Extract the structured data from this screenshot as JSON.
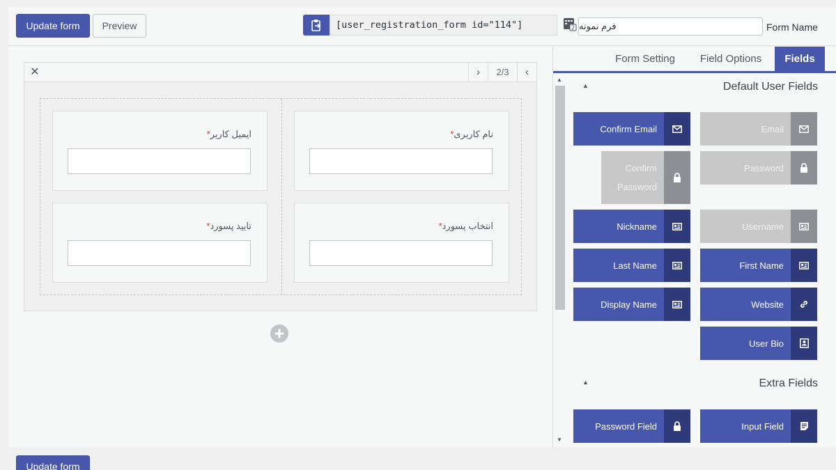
{
  "toolbar": {
    "update_label": "Update form",
    "preview_label": "Preview",
    "shortcode": "[user_registration_form id=\"114\"]",
    "form_name_value": "فرم نمونه",
    "form_name_label": "Form Name"
  },
  "builder": {
    "row_page": "2/3",
    "fields": [
      {
        "label": "نام کاربری",
        "required": "*"
      },
      {
        "label": "ایمیل کاربر",
        "required": "*"
      },
      {
        "label": "انتخاب پسورد",
        "required": "*"
      },
      {
        "label": "تایید پسورد",
        "required": "*"
      }
    ]
  },
  "panel": {
    "tabs": [
      {
        "label": "Form Setting"
      },
      {
        "label": "Field Options"
      },
      {
        "label": "Fields"
      }
    ],
    "default_section_title": "Default User Fields",
    "extra_section_title": "Extra Fields",
    "default_fields": [
      {
        "label": "Confirm Email",
        "icon": "envelope-icon",
        "state": "enabled"
      },
      {
        "label": "Email",
        "icon": "envelope-icon",
        "state": "disabled"
      },
      {
        "label": "Confirm Password",
        "icon": "lock-icon",
        "state": "disabled"
      },
      {
        "label": "Password",
        "icon": "lock-icon",
        "state": "disabled"
      },
      {
        "label": "Nickname",
        "icon": "id-card-icon",
        "state": "enabled"
      },
      {
        "label": "Username",
        "icon": "id-card-icon",
        "state": "disabled"
      },
      {
        "label": "Last Name",
        "icon": "id-card-icon",
        "state": "enabled"
      },
      {
        "label": "First Name",
        "icon": "id-card-icon",
        "state": "enabled"
      },
      {
        "label": "Display Name",
        "icon": "id-card-icon",
        "state": "enabled"
      },
      {
        "label": "Website",
        "icon": "link-icon",
        "state": "enabled"
      },
      {
        "label": "User Bio",
        "icon": "profile-icon",
        "state": "enabled"
      }
    ],
    "extra_fields": [
      {
        "label": "Password Field",
        "icon": "lock-icon",
        "state": "enabled"
      },
      {
        "label": "Input Field",
        "icon": "text-lines-icon",
        "state": "enabled"
      }
    ]
  },
  "colors": {
    "accent": "#4757ac",
    "accent_dark": "#2f3a7a",
    "disabled": "#c8c8c8",
    "required": "#d63638"
  }
}
